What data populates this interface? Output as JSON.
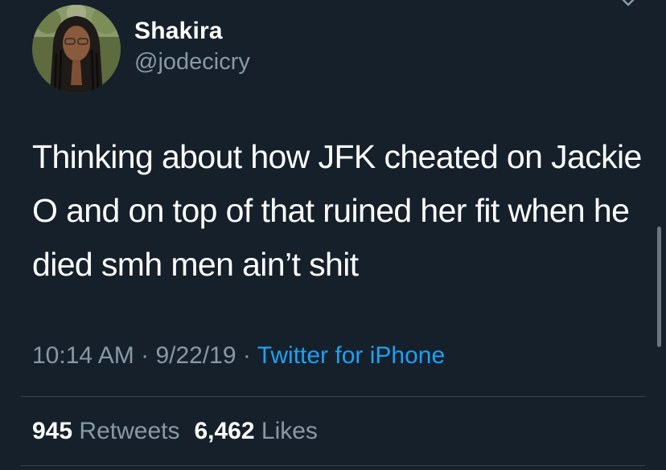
{
  "user": {
    "display_name": "Shakira",
    "handle": "@jodecicry"
  },
  "tweet": {
    "text": "Thinking about how JFK cheated on Jackie O and on top of that ruined her fit when he died smh men ain’t shit",
    "time": "10:14 AM",
    "date": "9/22/19",
    "separator": "·",
    "source": "Twitter for iPhone"
  },
  "stats": {
    "retweets_count": "945",
    "retweets_label": "Retweets",
    "likes_count": "6,462",
    "likes_label": "Likes"
  },
  "icons": {
    "menu_caret": "chevron-down-icon"
  },
  "colors": {
    "background": "#15202b",
    "secondary_text": "#8899a6",
    "link": "#1da1f2",
    "divider": "#38444d"
  }
}
